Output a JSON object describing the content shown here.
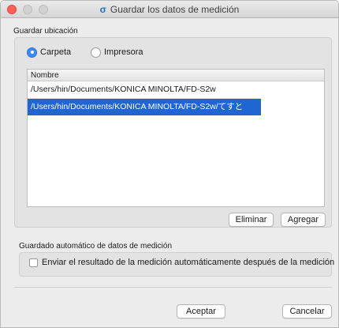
{
  "window": {
    "title": "Guardar los datos de medición",
    "title_icon": "app-icon"
  },
  "save_location": {
    "label": "Guardar ubicación",
    "options": [
      {
        "label": "Carpeta",
        "selected": true
      },
      {
        "label": "Impresora",
        "selected": false
      }
    ]
  },
  "folder_list": {
    "column_header": "Nombre",
    "rows": [
      {
        "path": "/Users/hin/Documents/KONICA MINOLTA/FD-S2w",
        "selected": false
      },
      {
        "path": "/Users/hin/Documents/KONICA MINOLTA/FD-S2w/てすと",
        "selected": true
      }
    ],
    "remove_label": "Eliminar",
    "add_label": "Agregar"
  },
  "auto_save": {
    "label": "Guardado automático de datos de medición",
    "checkbox_label": "Enviar el resultado de la medición automáticamente después de la medición",
    "checked": false
  },
  "footer": {
    "accept_label": "Aceptar",
    "cancel_label": "Cancelar"
  },
  "colors": {
    "selection": "#1f66d3",
    "radio_on": "#3a8bf2",
    "close_button": "#fc5f57"
  }
}
